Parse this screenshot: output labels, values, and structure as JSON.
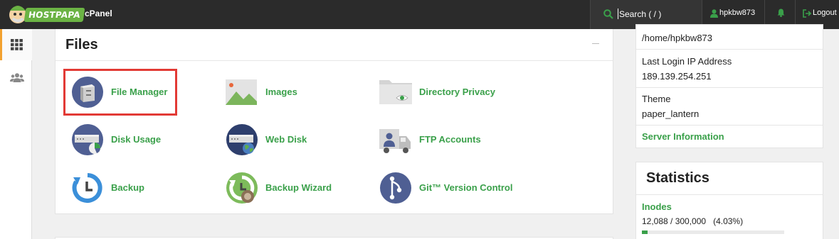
{
  "brand": {
    "logo_text": "HOSTPAPA",
    "product": "cPanel"
  },
  "header": {
    "search_placeholder": "Search ( / )",
    "username": "hpkbw873",
    "logout_label": "Logout"
  },
  "sidebar": {
    "items": [
      {
        "icon": "grid-icon",
        "active": true
      },
      {
        "icon": "users-icon",
        "active": false
      }
    ]
  },
  "files": {
    "title": "Files",
    "items": [
      {
        "label": "File Manager",
        "icon": "file-manager-icon",
        "highlighted": true
      },
      {
        "label": "Images",
        "icon": "images-icon"
      },
      {
        "label": "Directory Privacy",
        "icon": "directory-privacy-icon"
      },
      {
        "label": "Disk Usage",
        "icon": "disk-usage-icon"
      },
      {
        "label": "Web Disk",
        "icon": "web-disk-icon"
      },
      {
        "label": "FTP Accounts",
        "icon": "ftp-accounts-icon"
      },
      {
        "label": "Backup",
        "icon": "backup-icon"
      },
      {
        "label": "Backup Wizard",
        "icon": "backup-wizard-icon"
      },
      {
        "label": "Git™ Version Control",
        "icon": "git-version-control-icon"
      }
    ]
  },
  "general_info": {
    "home_directory": "/home/hpkbw873",
    "last_login_label": "Last Login IP Address",
    "last_login_ip": "189.139.254.251",
    "theme_label": "Theme",
    "theme_value": "paper_lantern",
    "server_info_link": "Server Information"
  },
  "statistics": {
    "title": "Statistics",
    "inodes_label": "Inodes",
    "inodes_value": "12,088 / 300,000   (4.03%)",
    "inodes_fraction": 0.0403
  },
  "colors": {
    "accent": "#3aa04a",
    "topbar": "#2b2b2b",
    "highlight_border": "#e23a35",
    "active_nav": "#f2a130"
  }
}
